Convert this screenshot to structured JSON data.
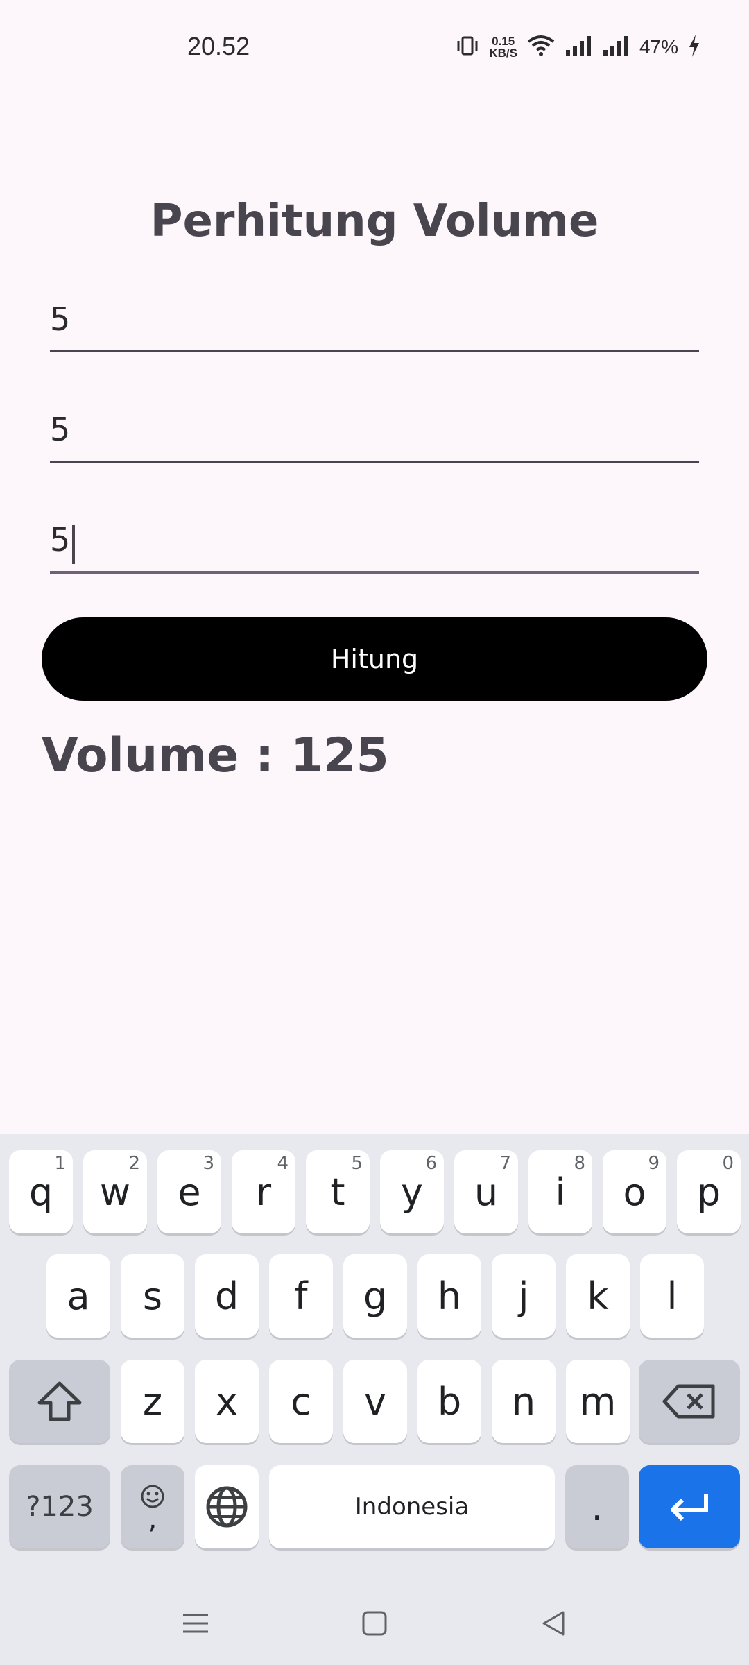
{
  "status": {
    "time": "20.52",
    "net_speed_value": "0.15",
    "net_speed_unit": "KB/S",
    "battery": "47%"
  },
  "app": {
    "title": "Perhitung Volume",
    "fields": [
      "5",
      "5",
      "5"
    ],
    "button_label": "Hitung",
    "result": "Volume : 125"
  },
  "keyboard": {
    "row1": [
      {
        "k": "q",
        "h": "1"
      },
      {
        "k": "w",
        "h": "2"
      },
      {
        "k": "e",
        "h": "3"
      },
      {
        "k": "r",
        "h": "4"
      },
      {
        "k": "t",
        "h": "5"
      },
      {
        "k": "y",
        "h": "6"
      },
      {
        "k": "u",
        "h": "7"
      },
      {
        "k": "i",
        "h": "8"
      },
      {
        "k": "o",
        "h": "9"
      },
      {
        "k": "p",
        "h": "0"
      }
    ],
    "row2": [
      "a",
      "s",
      "d",
      "f",
      "g",
      "h",
      "j",
      "k",
      "l"
    ],
    "row3": [
      "z",
      "x",
      "c",
      "v",
      "b",
      "n",
      "m"
    ],
    "symbols_label": "?123",
    "comma_label": ",",
    "space_label": "Indonesia",
    "period_label": ".",
    "enter_color": "#1a73e8"
  }
}
